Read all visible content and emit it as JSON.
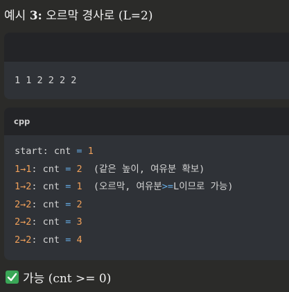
{
  "heading": {
    "prefix": "예시 ",
    "number": "3:",
    "rest": " 오르막 경사로 (L=2)"
  },
  "block1": {
    "line": "1 1 2 2 2 2"
  },
  "block2": {
    "lang": "cpp",
    "lines": [
      [
        {
          "t": "start:",
          "c": "kw"
        },
        {
          "t": " cnt ",
          "c": "kw"
        },
        {
          "t": "=",
          "c": "op"
        },
        {
          "t": " ",
          "c": "kw"
        },
        {
          "t": "1",
          "c": "num"
        }
      ],
      [
        {
          "t": "1",
          "c": "num"
        },
        {
          "t": "→",
          "c": "arrow"
        },
        {
          "t": "1",
          "c": "num"
        },
        {
          "t": ": cnt ",
          "c": "kw"
        },
        {
          "t": "=",
          "c": "op"
        },
        {
          "t": " ",
          "c": "kw"
        },
        {
          "t": "2",
          "c": "num"
        },
        {
          "t": "  (같은 높이, 여유분 확보)",
          "c": "cm"
        }
      ],
      [
        {
          "t": "1",
          "c": "num"
        },
        {
          "t": "→",
          "c": "arrow"
        },
        {
          "t": "2",
          "c": "num"
        },
        {
          "t": ": cnt ",
          "c": "kw"
        },
        {
          "t": "=",
          "c": "op"
        },
        {
          "t": " ",
          "c": "kw"
        },
        {
          "t": "1",
          "c": "num"
        },
        {
          "t": "  (오르막, 여유분",
          "c": "cm"
        },
        {
          "t": ">=",
          "c": "op"
        },
        {
          "t": "L이므로 가능)",
          "c": "cm"
        }
      ],
      [
        {
          "t": "2",
          "c": "num"
        },
        {
          "t": "→",
          "c": "arrow"
        },
        {
          "t": "2",
          "c": "num"
        },
        {
          "t": ": cnt ",
          "c": "kw"
        },
        {
          "t": "=",
          "c": "op"
        },
        {
          "t": " ",
          "c": "kw"
        },
        {
          "t": "2",
          "c": "num"
        }
      ],
      [
        {
          "t": "2",
          "c": "num"
        },
        {
          "t": "→",
          "c": "arrow"
        },
        {
          "t": "2",
          "c": "num"
        },
        {
          "t": ": cnt ",
          "c": "kw"
        },
        {
          "t": "=",
          "c": "op"
        },
        {
          "t": " ",
          "c": "kw"
        },
        {
          "t": "3",
          "c": "num"
        }
      ],
      [
        {
          "t": "2",
          "c": "num"
        },
        {
          "t": "→",
          "c": "arrow"
        },
        {
          "t": "2",
          "c": "num"
        },
        {
          "t": ": cnt ",
          "c": "kw"
        },
        {
          "t": "=",
          "c": "op"
        },
        {
          "t": " ",
          "c": "kw"
        },
        {
          "t": "4",
          "c": "num"
        }
      ]
    ]
  },
  "footer": {
    "icon": "check-mark-icon",
    "text": "가능 (cnt >= 0)"
  }
}
